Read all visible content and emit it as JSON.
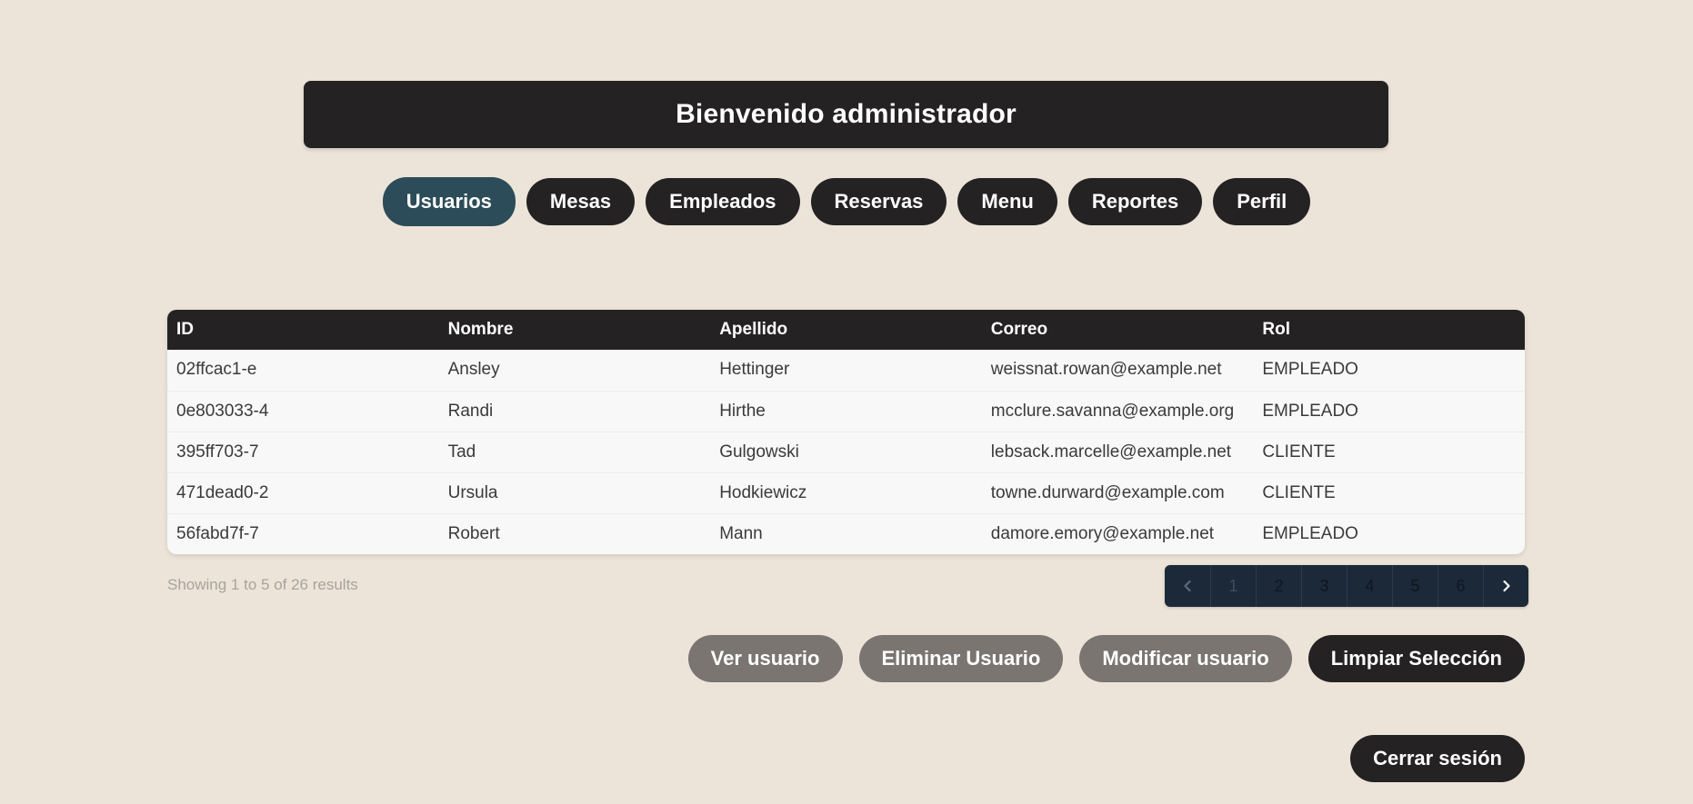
{
  "header": {
    "title": "Bienvenido administrador"
  },
  "nav": {
    "tabs": [
      {
        "label": "Usuarios"
      },
      {
        "label": "Mesas"
      },
      {
        "label": "Empleados"
      },
      {
        "label": "Reservas"
      },
      {
        "label": "Menu"
      },
      {
        "label": "Reportes"
      },
      {
        "label": "Perfil"
      }
    ]
  },
  "table": {
    "columns": [
      "ID",
      "Nombre",
      "Apellido",
      "Correo",
      "Rol"
    ],
    "rows": [
      [
        "02ffcac1-e",
        "Ansley",
        "Hettinger",
        "weissnat.rowan@example.net",
        "EMPLEADO"
      ],
      [
        "0e803033-4",
        "Randi",
        "Hirthe",
        "mcclure.savanna@example.org",
        "EMPLEADO"
      ],
      [
        "395ff703-7",
        "Tad",
        "Gulgowski",
        "lebsack.marcelle@example.net",
        "CLIENTE"
      ],
      [
        "471dead0-2",
        "Ursula",
        "Hodkiewicz",
        "towne.durward@example.com",
        "CLIENTE"
      ],
      [
        "56fabd7f-7",
        "Robert",
        "Mann",
        "damore.emory@example.net",
        "EMPLEADO"
      ]
    ]
  },
  "results": {
    "text": "Showing 1 to 5 of 26 results"
  },
  "pagination": {
    "pages": [
      "1",
      "2",
      "3",
      "4",
      "5",
      "6"
    ],
    "prev_icon": "chevron-left-icon",
    "next_icon": "chevron-right-icon"
  },
  "actions": {
    "view_label": "Ver usuario",
    "delete_label": "Eliminar Usuario",
    "edit_label": "Modificar usuario",
    "clear_label": "Limpiar Selección"
  },
  "logout": {
    "label": "Cerrar sesión"
  },
  "colors": {
    "background": "#ede4d9",
    "dark": "#242223",
    "active_tab": "#2b4c58",
    "disabled_button": "#7a7571",
    "pagination": "#1c2938"
  }
}
